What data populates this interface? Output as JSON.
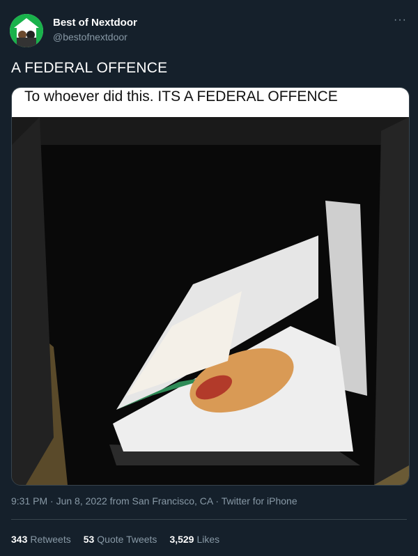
{
  "account": {
    "name": "Best of Nextdoor",
    "handle": "@bestofnextdoor",
    "more_label": "···"
  },
  "tweet": {
    "text": "A FEDERAL OFFENCE",
    "image_caption": "To whoever did this. ITS A FEDERAL OFFENCE"
  },
  "meta": {
    "time": "9:31 PM",
    "date": "Jun 8, 2022",
    "location": "from San Francisco, CA",
    "client": "Twitter for iPhone"
  },
  "stats": {
    "retweets_count": "343",
    "retweets_label": "Retweets",
    "quote_count": "53",
    "quote_label": "Quote Tweets",
    "likes_count": "3,529",
    "likes_label": "Likes"
  },
  "colors": {
    "background": "#15202b",
    "muted_text": "#8899a6",
    "divider": "#38444d",
    "brand_green": "#19b24b"
  }
}
